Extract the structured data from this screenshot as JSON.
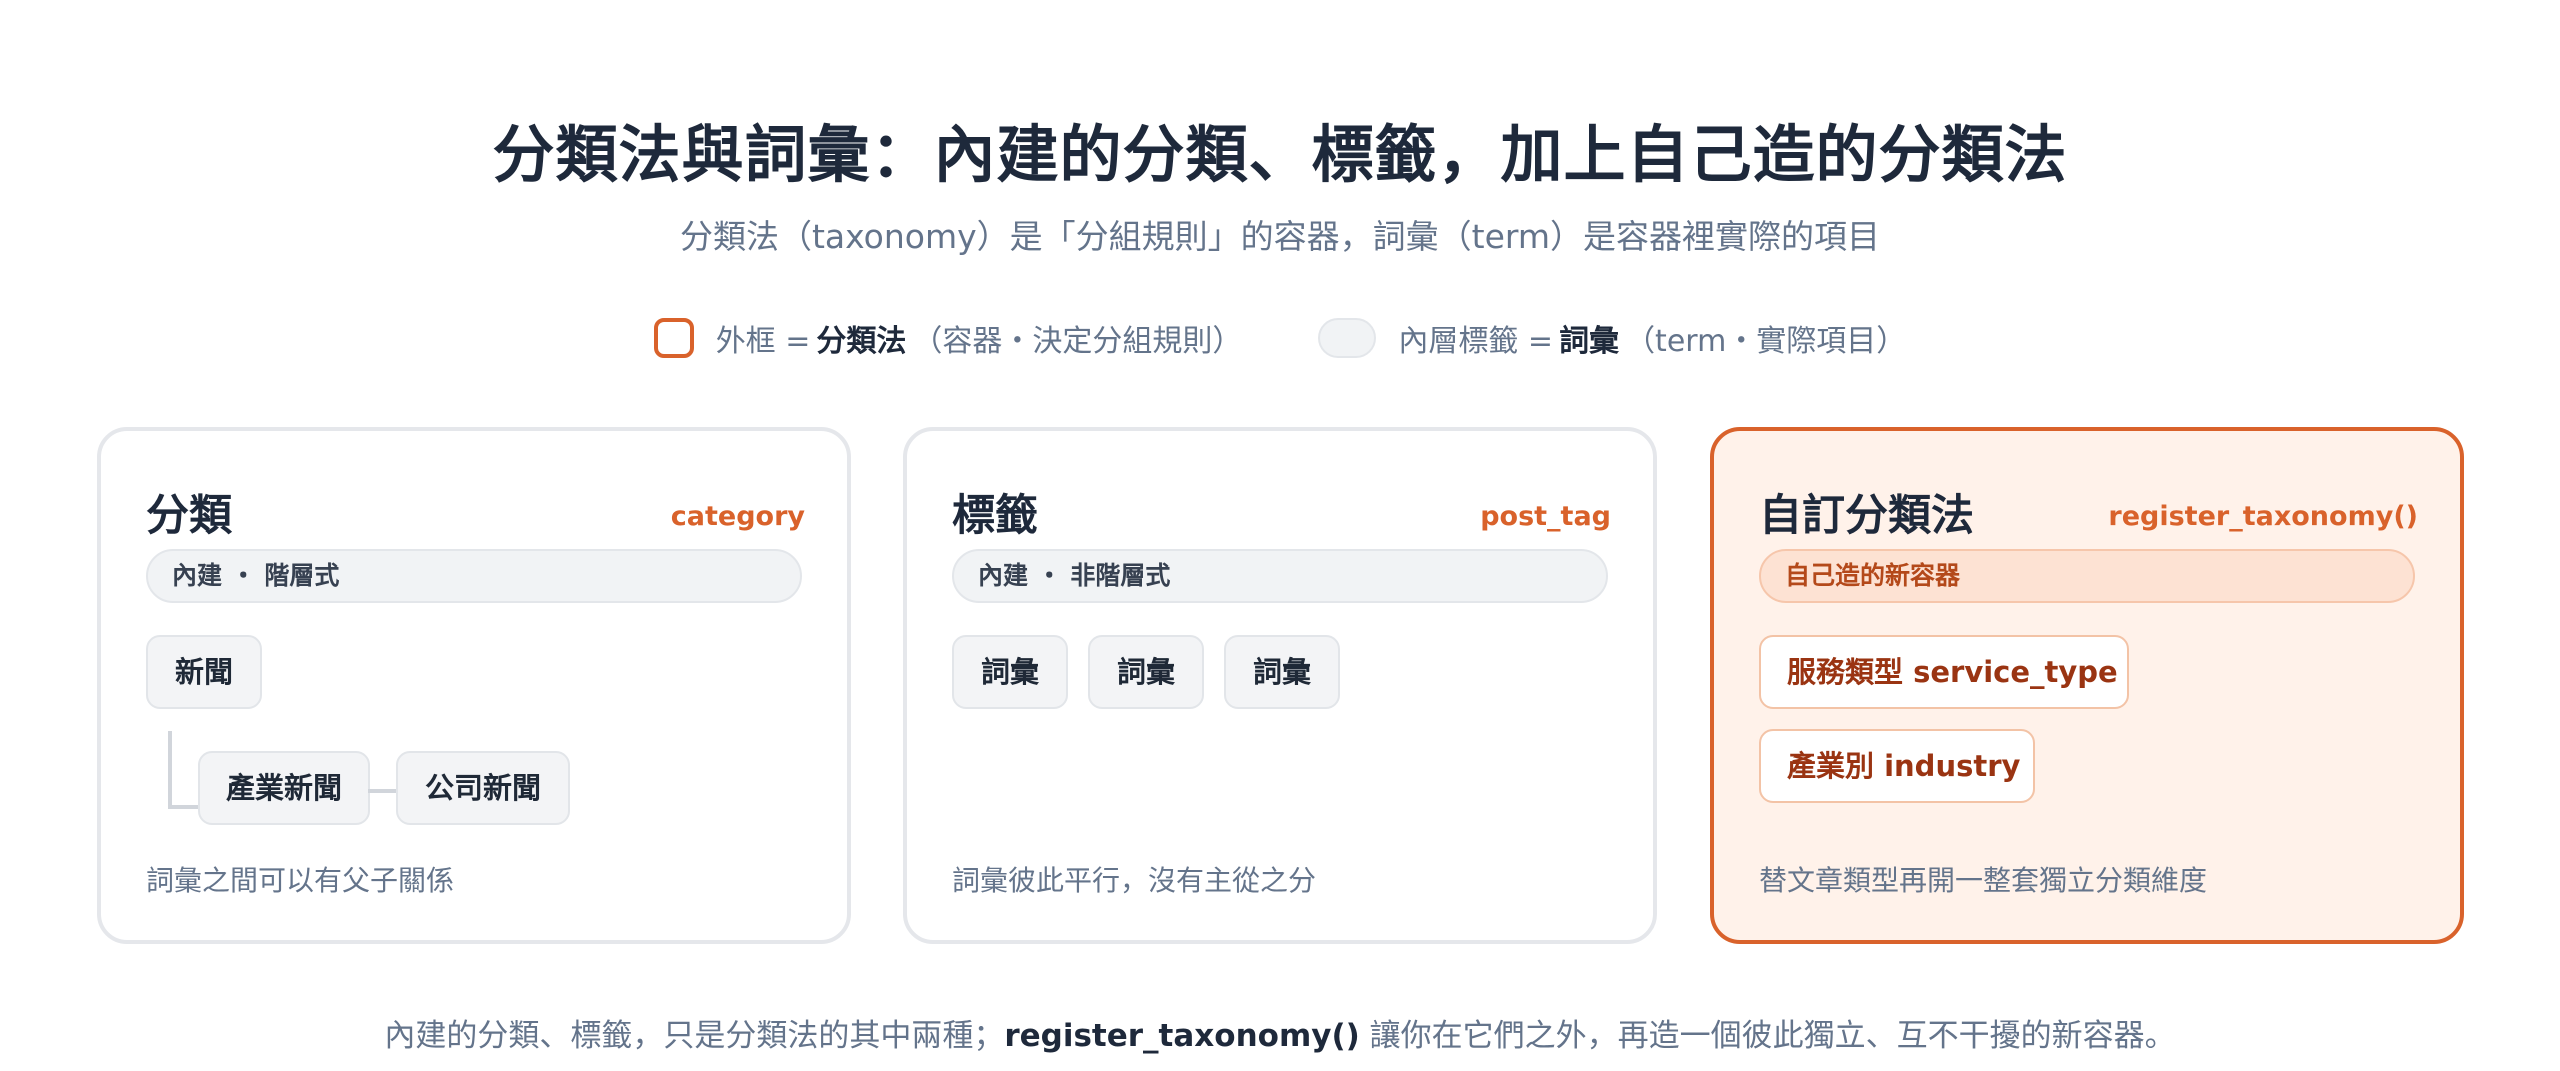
{
  "header": {
    "title": "分類法與詞彙：內建的分類、標籤，加上自己造的分類法",
    "subtitle": "分類法（taxonomy）是「分組規則」的容器，詞彙（term）是容器裡實際的項目"
  },
  "legend": {
    "outline": {
      "prefix": "外框 =",
      "strong": "分類法",
      "suffix": "（容器・決定分組規則）"
    },
    "fill": {
      "prefix": "內層標籤 =",
      "strong": "詞彙",
      "suffix": "（term・實際項目）"
    }
  },
  "cards": [
    {
      "title": "分類",
      "code": "category",
      "pill": "內建 ・ 階層式",
      "terms": [
        "新聞",
        "產業新聞",
        "公司新聞"
      ],
      "note": "詞彙之間可以有父子關係"
    },
    {
      "title": "標籤",
      "code": "post_tag",
      "pill": "內建 ・ 非階層式",
      "terms": [
        "詞彙",
        "詞彙",
        "詞彙"
      ],
      "note": "詞彙彼此平行，沒有主從之分"
    },
    {
      "title": "自訂分類法",
      "code": "register_taxonomy()",
      "pill": "自己造的新容器",
      "terms": [
        "服務類型 service_type",
        "產業別 industry"
      ],
      "note": "替文章類型再開一整套獨立分類維度"
    }
  ],
  "footer": {
    "before": "內建的分類、標籤，只是分類法的其中兩種；",
    "strong": "register_taxonomy()",
    "after": " 讓你在它們之外，再造一個彼此獨立、互不干擾的新容器。"
  },
  "colors": {
    "accent": "#d9622b",
    "custom_card_bg": "#fff2ea",
    "neutral_border": "#e5e7eb",
    "title_text": "#1e293b",
    "muted_text": "#64748b"
  }
}
